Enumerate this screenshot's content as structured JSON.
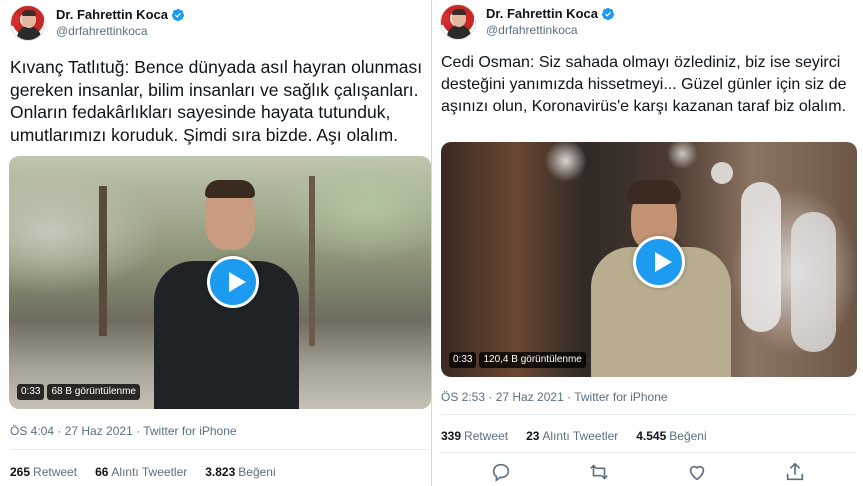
{
  "left_tweet": {
    "author": {
      "display_name": "Dr. Fahrettin Koca",
      "handle": "@drfahrettinkoca",
      "verified": true
    },
    "text": "Kıvanç Tatlıtuğ: Bence dünyada asıl hayran olunması gereken insanlar, bilim insanları ve sağlık çalışanları. Onların fedakârlıkları sayesinde hayata tutunduk, umutlarımızı koruduk. Şimdi sıra bizde. Aşı olalım.",
    "video": {
      "duration": "0:33",
      "views": "68 B görüntülenme"
    },
    "timestamp": "ÖS 4:04 · 27 Haz 2021 · Twitter for iPhone",
    "stats": [
      {
        "count": "265",
        "label": "Retweet"
      },
      {
        "count": "66",
        "label": "Alıntı Tweetler"
      },
      {
        "count": "3.823",
        "label": "Beğeni"
      }
    ]
  },
  "right_tweet": {
    "author": {
      "display_name": "Dr. Fahrettin Koca",
      "handle": "@drfahrettinkoca",
      "verified": true
    },
    "text": "Cedi Osman: Siz sahada olmayı özlediniz, biz ise seyirci desteğini yanımızda hissetmeyi... Güzel günler için siz de aşınızı olun, Koronavirüs'e karşı kazanan taraf biz olalım.",
    "video": {
      "duration": "0:33",
      "views": "120,4 B görüntülenme"
    },
    "timestamp": "ÖS 2:53 · 27 Haz 2021 · Twitter for iPhone",
    "stats": [
      {
        "count": "339",
        "label": "Retweet"
      },
      {
        "count": "23",
        "label": "Alıntı Tweetler"
      },
      {
        "count": "4.545",
        "label": "Beğeni"
      }
    ],
    "actions": [
      "reply-icon",
      "retweet-icon",
      "like-icon",
      "share-icon"
    ]
  },
  "colors": {
    "accent": "#1d9bf0",
    "text": "#0f1419",
    "muted": "#5b7083",
    "divider": "#e6ecf0"
  }
}
